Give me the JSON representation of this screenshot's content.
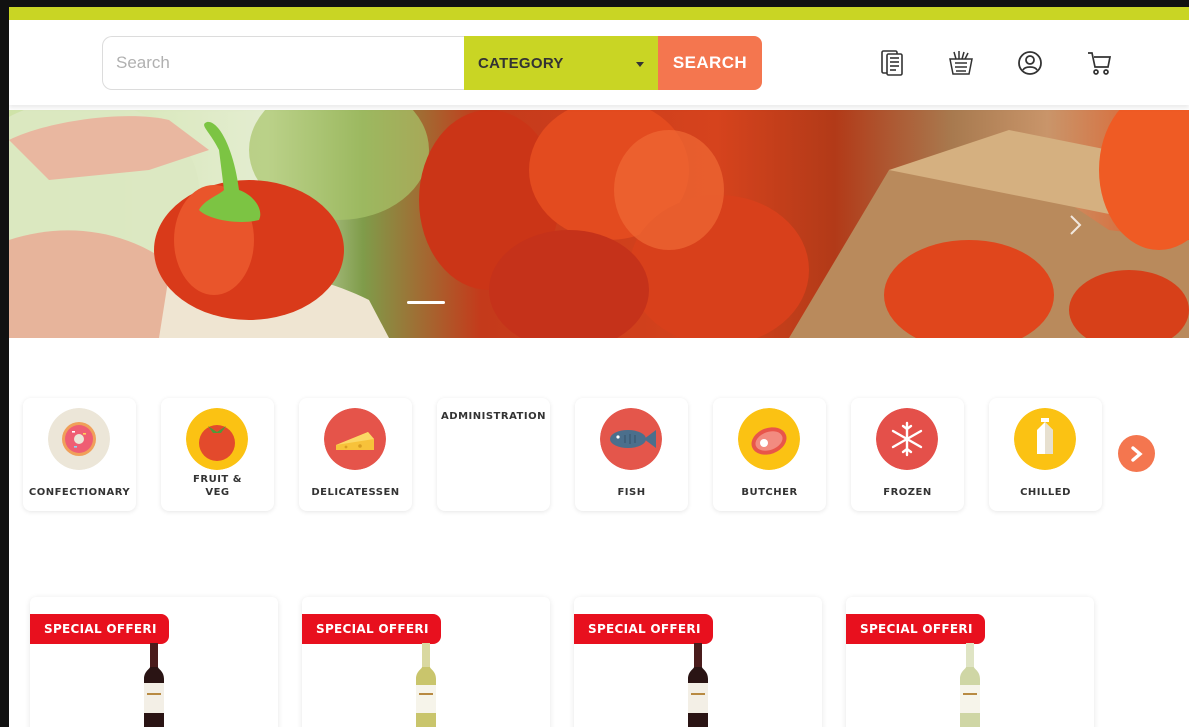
{
  "colors": {
    "accent": "#c9d524",
    "cta": "#f4764f",
    "offer": "#e8101e"
  },
  "search": {
    "placeholder": "Search",
    "category_label": "CATEGORY",
    "button_label": "SEARCH"
  },
  "header_icons": [
    "receipt-icon",
    "basket-icon",
    "user-icon",
    "cart-icon"
  ],
  "categories": [
    {
      "label": "CONFECTIONARY",
      "icon": "donut-icon"
    },
    {
      "label": "FRUIT & VEG",
      "icon": "tomato-icon"
    },
    {
      "label": "DELICATESSEN",
      "icon": "cheese-icon"
    },
    {
      "label": "ADMINISTRATION",
      "icon": ""
    },
    {
      "label": "FISH",
      "icon": "fish-icon"
    },
    {
      "label": "BUTCHER",
      "icon": "steak-icon"
    },
    {
      "label": "FROZEN",
      "icon": "snowflake-icon"
    },
    {
      "label": "CHILLED",
      "icon": "milk-carton-icon"
    }
  ],
  "products": [
    {
      "badge": "SPECIAL OFFERI",
      "wine": "red"
    },
    {
      "badge": "SPECIAL OFFERI",
      "wine": "white"
    },
    {
      "badge": "SPECIAL OFFERI",
      "wine": "red"
    },
    {
      "badge": "SPECIAL OFFERI",
      "wine": "white"
    }
  ]
}
